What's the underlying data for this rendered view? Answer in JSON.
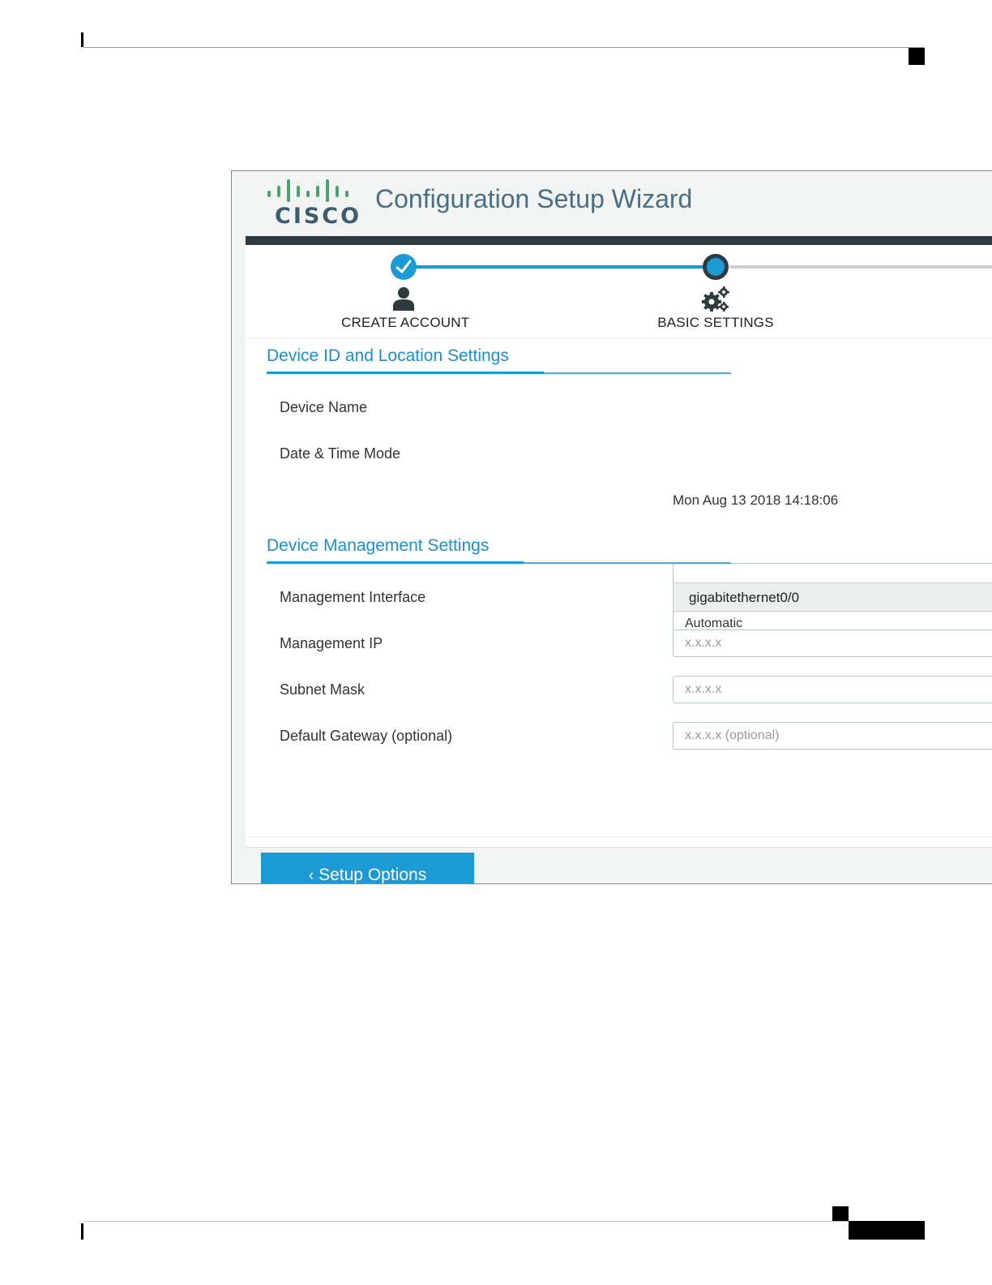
{
  "app": {
    "title": "Configuration Setup Wizard",
    "logo_text": "CISCO"
  },
  "stepper": {
    "steps": [
      {
        "label": "CREATE ACCOUNT",
        "status": "complete",
        "icon": "user-icon"
      },
      {
        "label": "BASIC SETTINGS",
        "status": "current",
        "icon": "gears-icon"
      }
    ]
  },
  "device_id_section": {
    "title": "Device ID and Location Settings",
    "device_name": {
      "label": "Device Name",
      "value": "",
      "placeholder": ""
    },
    "date_time_mode": {
      "label": "Date & Time Mode",
      "value": "Automatic"
    },
    "current_datetime": "Mon Aug 13 2018 14:18:06"
  },
  "management_section": {
    "title": "Device Management Settings",
    "management_interface": {
      "label": "Management Interface",
      "value": "gigabitethernet0/0"
    },
    "management_ip": {
      "label": "Management IP",
      "placeholder": "x.x.x.x"
    },
    "subnet_mask": {
      "label": "Subnet Mask",
      "placeholder": "x.x.x.x"
    },
    "default_gateway": {
      "label": "Default Gateway (optional)",
      "placeholder": "x.x.x.x (optional)"
    }
  },
  "actions": {
    "back_label": "Setup Options",
    "back_chevron": "‹"
  },
  "colors": {
    "accent": "#1c9ad6",
    "dark_band": "#2d3a3f",
    "title_text": "#4a6f83"
  }
}
